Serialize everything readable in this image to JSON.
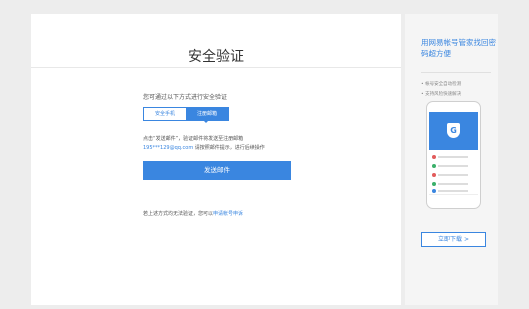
{
  "main": {
    "title": "安全验证",
    "prompt": "您可通过以下方式进行安全验证",
    "tabs": [
      {
        "label": "安全手机",
        "active": false
      },
      {
        "label": "注册邮箱",
        "active": true
      }
    ],
    "info_prefix": "点击“发送邮件”，验证邮件将发送至注册邮箱",
    "email": "195***129@qq.com",
    "info_suffix": "请按照邮件提示，进行后续操作",
    "send_button": "发送邮件",
    "footer_text": "若上述方式均无法验证，您可以",
    "footer_link": "申请帐号申诉"
  },
  "side": {
    "title": "用网易帐号管家找回密码超方便",
    "bullets": [
      "帐号安全自动检测",
      "支持风险快速解决"
    ],
    "download_button": "立即下载 >",
    "phone_icon": "shield-icon",
    "phone_icon_glyph": "G"
  },
  "colors": {
    "accent": "#3a86e0",
    "row_dots": [
      "#e25b5b",
      "#3ab06a",
      "#e25b5b",
      "#3ab06a",
      "#3a86e0"
    ]
  }
}
